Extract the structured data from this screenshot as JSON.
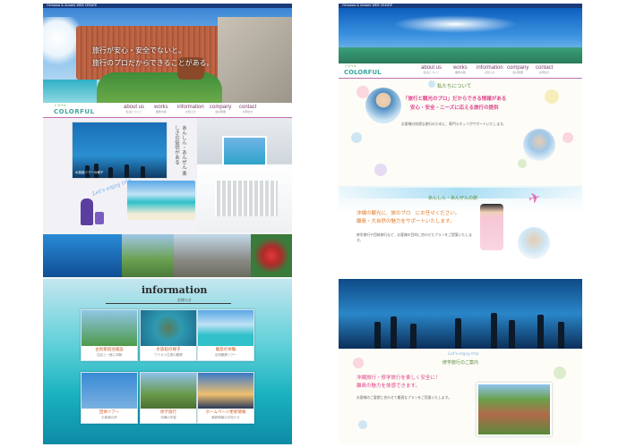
{
  "left": {
    "topbar": "Okinawa & Amami WEB CREATE",
    "hero": {
      "line1": "旅行が安心・安全でないと。",
      "line2": "旅行のプロだからできることがある。"
    },
    "logo": {
      "small": "トラベル",
      "main": "COLORFUL"
    },
    "nav": [
      {
        "label": "about us",
        "sub": "私達について"
      },
      {
        "label": "works",
        "sub": "業務内容"
      },
      {
        "label": "information",
        "sub": "お知らせ"
      },
      {
        "label": "company",
        "sub": "会社概要"
      },
      {
        "label": "contact",
        "sub": "お問合せ"
      }
    ],
    "vertical_text": "あんしん・あんぜん 楽しさの提供がある",
    "script_text": "Let's enjoy trip",
    "aquarium_caption": "水族館ツアーの様子",
    "info": {
      "title": "information",
      "subtitle": "お知らせ",
      "cards": [
        {
          "caption": "古民家宿泊施設",
          "text": "住民と一緒に体験"
        },
        {
          "caption": "水族館の様子",
          "text": "ウミガメ生態の観察"
        },
        {
          "caption": "離島の体験",
          "text": "自然観察ツアー"
        },
        {
          "caption": "団体ツアー",
          "text": "お客様の声"
        },
        {
          "caption": "修学旅行",
          "text": "沖縄の学習"
        },
        {
          "caption": "ホームページ更新情報",
          "text": "最新情報のお知らせ"
        }
      ]
    }
  },
  "right": {
    "topbar": "Okinawa & Amami WEB CREATE",
    "logo": {
      "small": "トラベル",
      "main": "COLORFUL"
    },
    "nav": [
      {
        "label": "about us",
        "sub": "私達について"
      },
      {
        "label": "works",
        "sub": "業務内容"
      },
      {
        "label": "information",
        "sub": "お知らせ"
      },
      {
        "label": "company",
        "sub": "会社概要"
      },
      {
        "label": "contact",
        "sub": "お問合せ"
      }
    ],
    "about": {
      "heading": "私たちについて",
      "pink1": "「旅行と観光のプロ」だからできる情報がある",
      "pink2": "安心・安全・ニーズに応える旅行の提供",
      "body": "お客様の快適な旅行のために、専門スタッフがサポートいたします。"
    },
    "section2": {
      "title": "あんしん・あんぜんの旅",
      "heading1": "沖縄の観光に、旅のプロ　にお任せください。",
      "heading2": "離島・大自然の魅力をサポートいたします。",
      "body": "修学旅行や団体旅行など、お客様の目的に合わせたプランをご提案いたします。"
    },
    "section3": {
      "script_text": "Let's enjoy trip",
      "title": "修学旅行のご案内",
      "heading1": "沖縄旅行・修学旅行を楽しく安全に！",
      "heading2": "離島の魅力を体感できます。",
      "body": "お客様のご要望に合わせて最適なプランをご用意いたします。"
    }
  },
  "colors": {
    "nav_text": "#7a3f6e",
    "pink": "#e0408a",
    "accent_green": "#5fae4a",
    "sky": "#1c8fd8",
    "sea": "#3fc4d6"
  }
}
